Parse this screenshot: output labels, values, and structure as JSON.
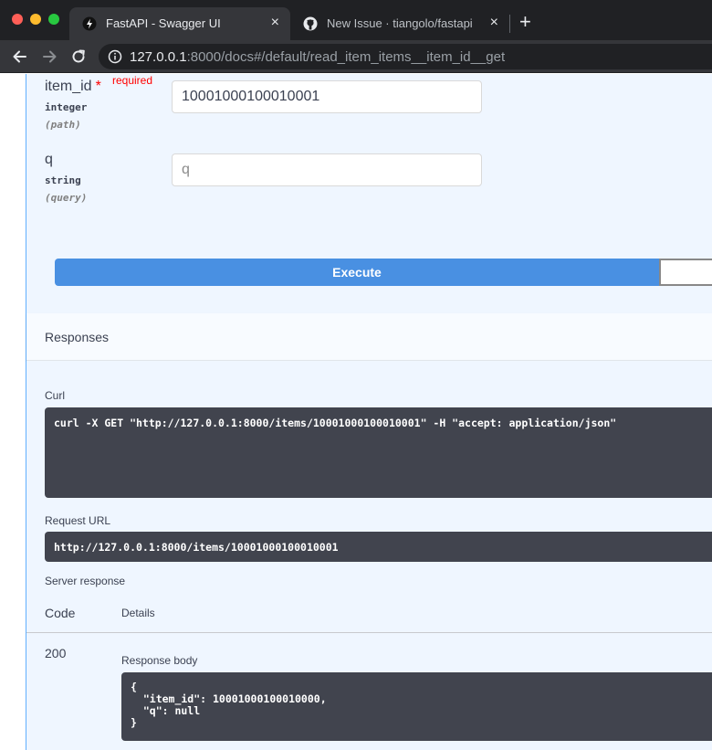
{
  "browser": {
    "tabs": [
      {
        "title": "FastAPI - Swagger UI",
        "close": "×"
      },
      {
        "title": "New Issue · tiangolo/fastapi",
        "close": "×"
      }
    ],
    "new_tab": "+",
    "url": {
      "host": "127.0.0.1",
      "rest": ":8000/docs#/default/read_item_items__item_id__get"
    }
  },
  "params": [
    {
      "name": "item_id",
      "required_star": "*",
      "required_text": "required",
      "type": "integer",
      "in": "(path)",
      "value": "10001000100010001",
      "placeholder": ""
    },
    {
      "name": "q",
      "type": "string",
      "in": "(query)",
      "value": "",
      "placeholder": "q"
    }
  ],
  "execute_label": "Execute",
  "responses": {
    "title": "Responses",
    "curl_label": "Curl",
    "curl": "curl -X GET \"http://127.0.0.1:8000/items/10001000100010001\" -H \"accept: application/json\"",
    "request_url_label": "Request URL",
    "request_url": "http://127.0.0.1:8000/items/10001000100010001",
    "server_response_label": "Server response",
    "code_header": "Code",
    "details_header": "Details",
    "status_code": "200",
    "response_body_label": "Response body",
    "response_body": "{\n  \"item_id\": 10001000100010000,\n  \"q\": null\n}"
  },
  "colors": {
    "accent": "#4990e2",
    "required": "#ff0000",
    "code_bg": "#41444e",
    "opblock_bg": "#eff6ff",
    "opblock_border": "#61affe"
  },
  "icons": [
    "fastapi-favicon-icon",
    "github-favicon-icon",
    "back-arrow-icon",
    "forward-arrow-icon",
    "reload-icon",
    "info-icon"
  ]
}
